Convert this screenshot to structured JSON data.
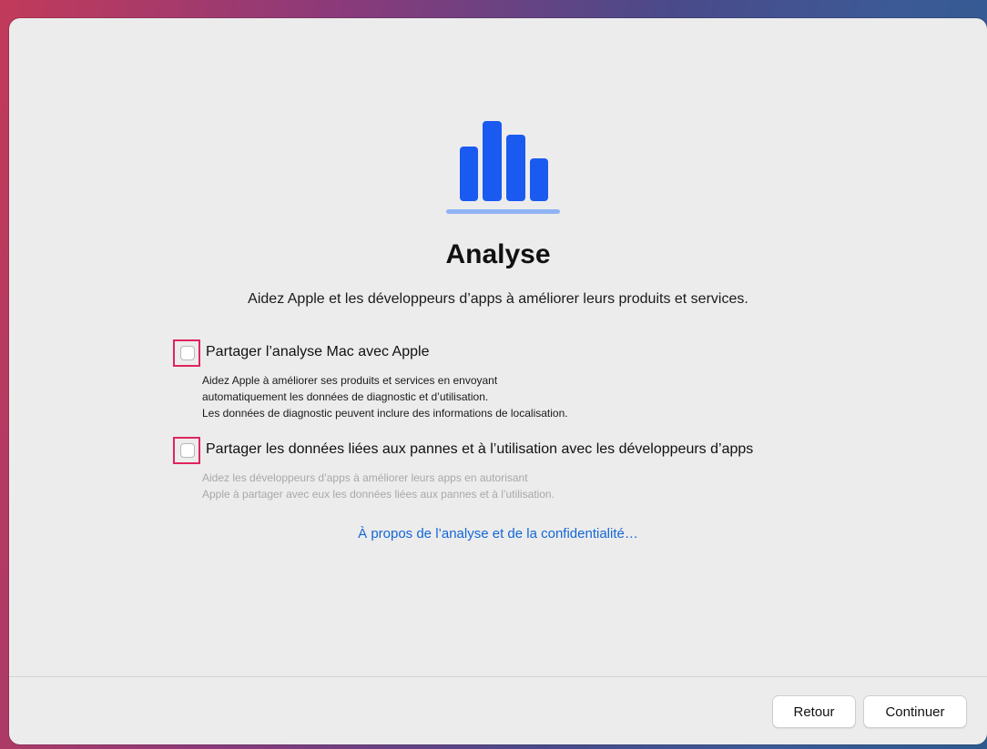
{
  "page": {
    "title": "Analyse",
    "subtitle": "Aidez Apple et les développeurs d’apps à améliorer leurs produits et services."
  },
  "logo": {
    "icon": "bar-chart-icon",
    "color": "#1b5af0"
  },
  "options": [
    {
      "label": "Partager l’analyse Mac avec Apple",
      "checked": false,
      "description": [
        "Aidez Apple à améliorer ses produits et services en envoyant",
        "automatiquement les données de diagnostic et d’utilisation.",
        "Les données de diagnostic peuvent inclure des informations de localisation."
      ]
    },
    {
      "label": "Partager les données liées aux pannes et à l’utilisation avec les développeurs d’apps",
      "checked": false,
      "description": [
        "Aidez les développeurs d’apps à améliorer leurs apps en autorisant",
        "Apple à partager avec eux les données liées aux pannes et à l’utilisation."
      ]
    }
  ],
  "link": {
    "label": "À propos de l’analyse et de la confidentialité…",
    "color": "#1467d6"
  },
  "footer": {
    "back_label": "Retour",
    "continue_label": "Continuer"
  },
  "colors": {
    "highlight": "#e0245e"
  }
}
